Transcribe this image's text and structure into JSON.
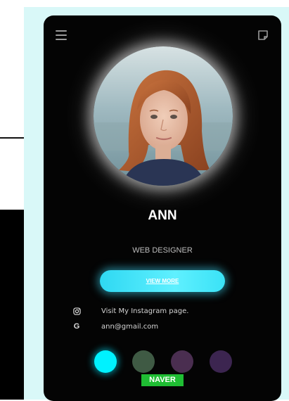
{
  "profile": {
    "name": "ANN",
    "role": "WEB DESIGNER",
    "view_more_label": "VIEW MORE"
  },
  "contacts": {
    "instagram_text": "Visit My Instagram page.",
    "instagram_icon": "instagram-icon",
    "google_icon_glyph": "G",
    "email": "ann@gmail.com"
  },
  "colors": {
    "accent": "#2fd8f2",
    "card_bg": "#040404",
    "backdrop": "#d9f8f8",
    "badge": "#1fbd33",
    "swatches": [
      "#00f2ff",
      "#3f5a44",
      "#4a2e50",
      "#3c2550"
    ]
  },
  "badge": {
    "label": "NAVER"
  }
}
